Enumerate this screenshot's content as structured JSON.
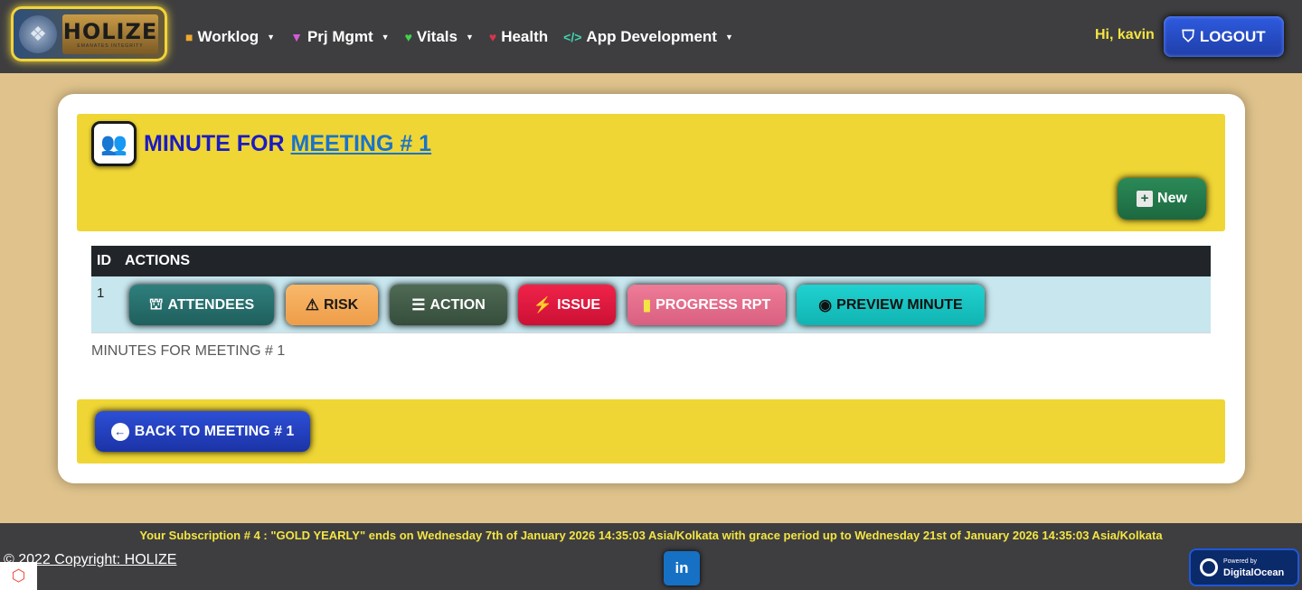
{
  "nav": {
    "logo_text": "HOLIZE",
    "logo_tagline": "EMANATES INTEGRITY",
    "menu": [
      {
        "label": "Worklog",
        "icon": "briefcase-icon",
        "dropdown": true
      },
      {
        "label": "Prj Mgmt",
        "icon": "hierarchy-icon",
        "dropdown": true
      },
      {
        "label": "Vitals",
        "icon": "heart-pulse-icon",
        "dropdown": true
      },
      {
        "label": "Health",
        "icon": "heart-icon",
        "dropdown": false
      },
      {
        "label": "App Development",
        "icon": "code-icon",
        "dropdown": true
      }
    ],
    "greeting": "Hi, kavin",
    "logout_label": "LOGOUT"
  },
  "card": {
    "title_prefix": "MINUTE FOR",
    "title_link": "MEETING # 1",
    "new_label": "New",
    "table": {
      "headers": [
        "ID",
        "ACTIONS"
      ],
      "rows": [
        {
          "id": "1",
          "actions": [
            "ATTENDEES",
            "RISK",
            "ACTION",
            "ISSUE",
            "PROGRESS RPT",
            "PREVIEW MINUTE"
          ]
        }
      ]
    },
    "caption": "MINUTES FOR MEETING # 1",
    "back_label": "BACK TO MEETING # 1"
  },
  "footer": {
    "subscription": "Your Subscription # 4 : \"GOLD YEARLY\" ends on Wednesday 7th of January 2026 14:35:03 Asia/Kolkata with grace period up to Wednesday 21st of January 2026 14:35:03 Asia/Kolkata",
    "copyright": "© 2022 Copyright: HOLIZE",
    "linkedin_label": "in",
    "do_small": "Powered by",
    "do_big": "DigitalOcean"
  },
  "colors": {
    "navbar": "#3e3e40",
    "page_bg": "#e0c38c",
    "header_yellow": "#efd634",
    "title_blue": "#1b1bc2",
    "greeting_yellow": "#f4e542"
  }
}
